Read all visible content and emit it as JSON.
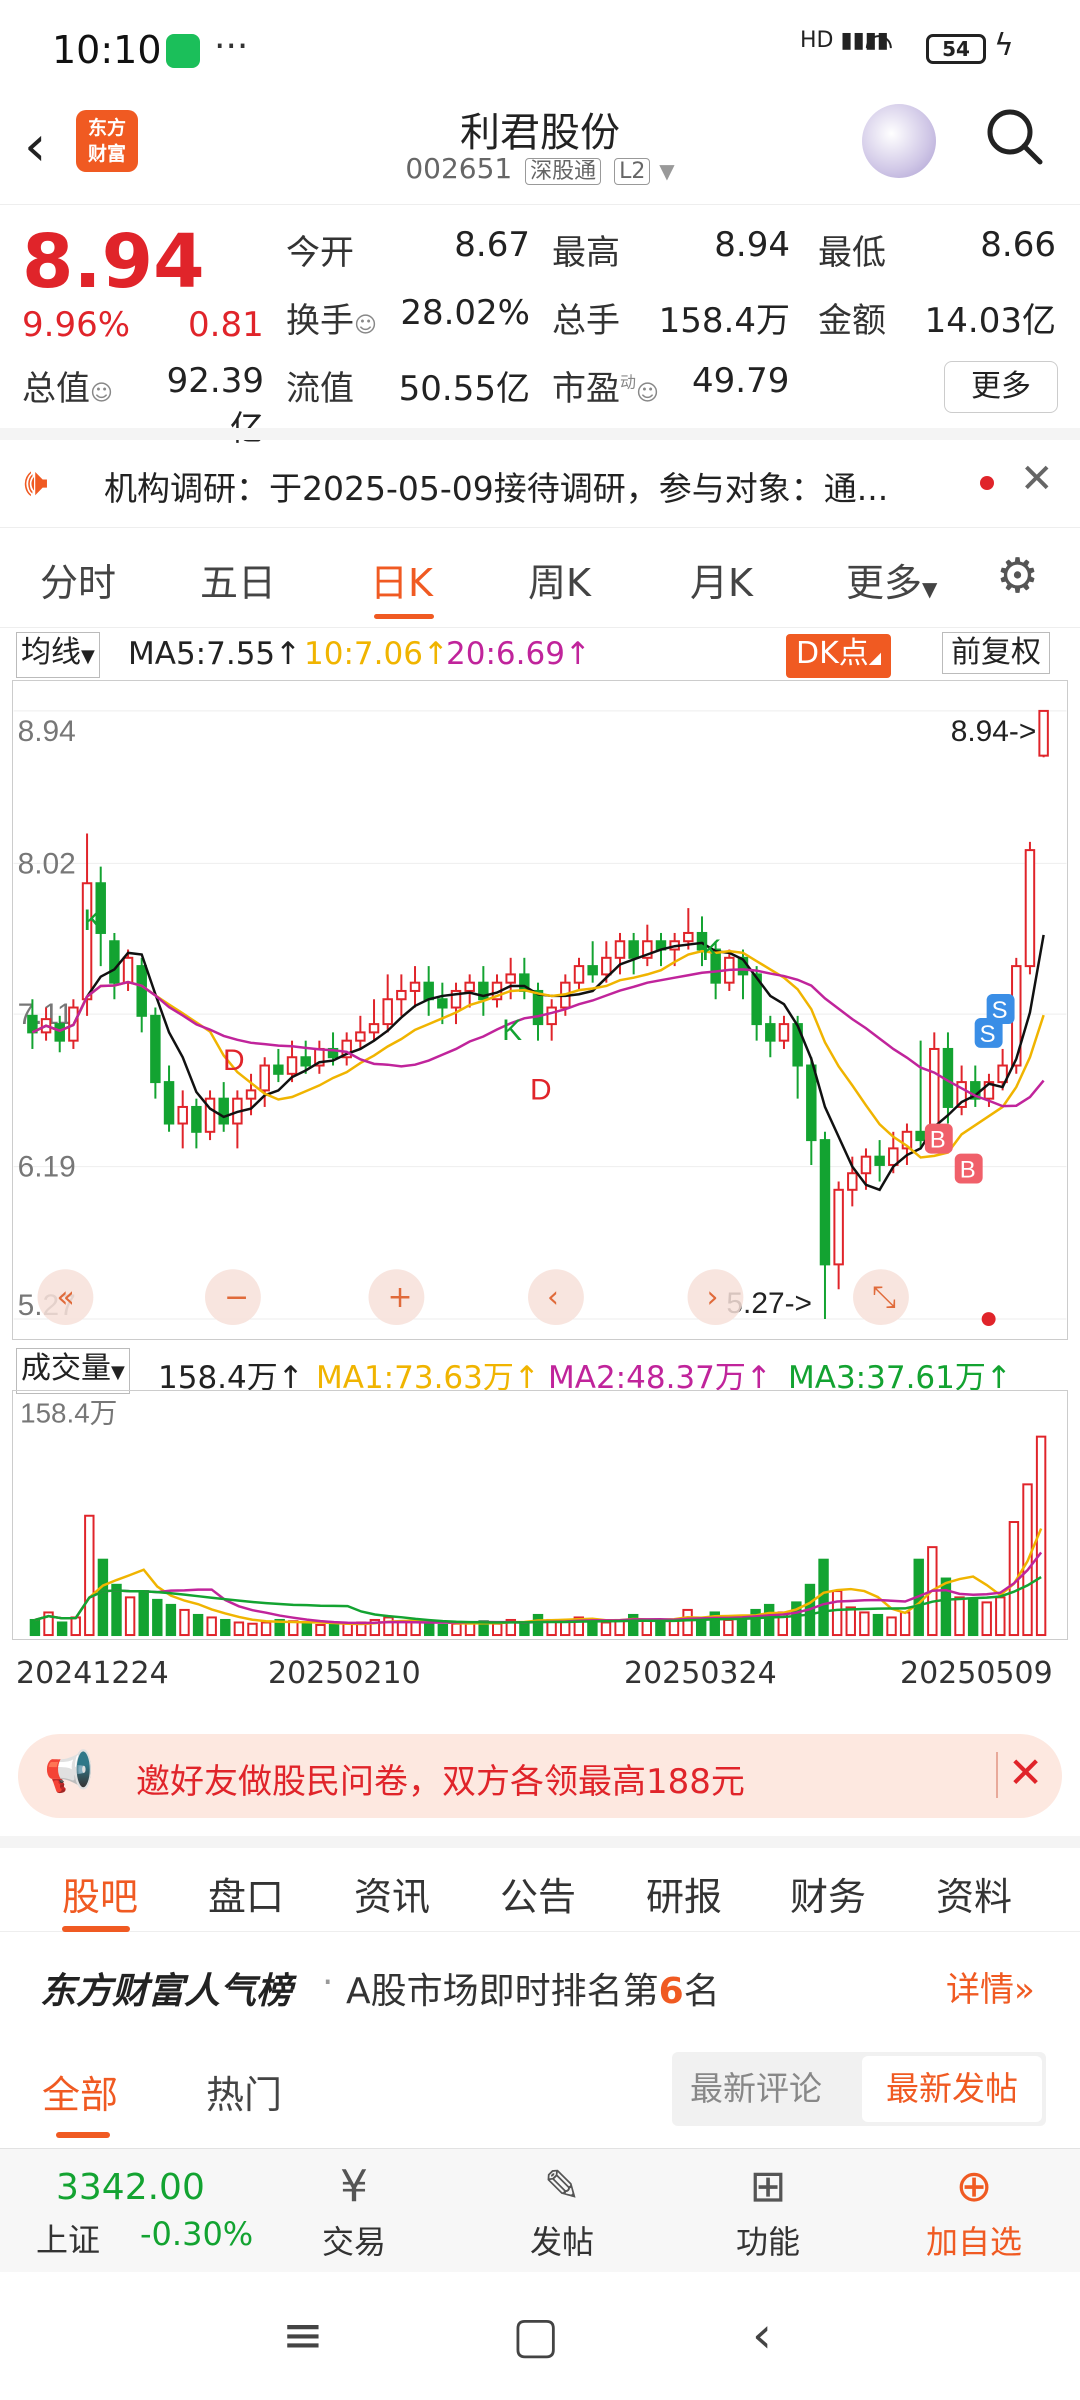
{
  "status_bar": {
    "time": "10:10",
    "battery": "54",
    "signal": "HD"
  },
  "header": {
    "stock_name": "利君股份",
    "stock_code": "002651",
    "market_tag": "深股通",
    "level_tag": "L2",
    "logo_text_1": "东方",
    "logo_text_2": "财富"
  },
  "quote": {
    "price": "8.94",
    "change_pct": "9.96%",
    "change_val": "0.81",
    "fields": [
      {
        "label": "今开",
        "value": "8.67",
        "color": "#e0242a"
      },
      {
        "label": "最高",
        "value": "8.94",
        "color": "#e0242a"
      },
      {
        "label": "最低",
        "value": "8.66",
        "color": "#e0242a"
      },
      {
        "label": "换手",
        "value": "28.02%",
        "color": "#222222"
      },
      {
        "label": "总手",
        "value": "158.4万",
        "color": "#222222"
      },
      {
        "label": "金额",
        "value": "14.03亿",
        "color": "#222222"
      },
      {
        "label": "总值",
        "value": "92.39亿",
        "color": "#222222"
      },
      {
        "label": "流值",
        "value": "50.55亿",
        "color": "#222222"
      },
      {
        "label": "市盈",
        "value": "49.79",
        "color": "#222222"
      }
    ],
    "more": "更多",
    "pe_sup": "动"
  },
  "ticker": {
    "text": "机构调研：于2025-05-09接待调研，参与对象：通..."
  },
  "chart_tabs": [
    "分时",
    "五日",
    "日K",
    "周K",
    "月K",
    "更多"
  ],
  "ma_row": {
    "selector": "均线",
    "ma5": "MA5:7.55",
    "ma10": "10:7.06",
    "ma20": "20:6.69",
    "dk": "DK点",
    "fq": "前复权"
  },
  "chart_data": {
    "type": "candlestick",
    "y_ticks": [
      "8.94",
      "8.02",
      "7.11",
      "6.19",
      "5.27"
    ],
    "ylim": [
      5.27,
      8.94
    ],
    "high_marker": "8.94->",
    "low_marker": "5.27->",
    "signal_labels": [
      "K",
      "D",
      "K",
      "D",
      "K",
      "S",
      "S",
      "B",
      "B"
    ],
    "dates": [
      "20241224",
      "20250210",
      "20250324",
      "20250509"
    ],
    "candles": [
      [
        7.1,
        7.0,
        7.2,
        6.9
      ],
      [
        7.0,
        7.08,
        7.15,
        6.95
      ],
      [
        7.05,
        6.95,
        7.1,
        6.88
      ],
      [
        6.95,
        7.15,
        7.2,
        6.9
      ],
      [
        7.2,
        7.9,
        8.2,
        7.1
      ],
      [
        7.9,
        7.6,
        8.0,
        7.4
      ],
      [
        7.55,
        7.3,
        7.6,
        7.2
      ],
      [
        7.3,
        7.45,
        7.5,
        7.25
      ],
      [
        7.4,
        7.1,
        7.45,
        7.0
      ],
      [
        7.1,
        6.7,
        7.15,
        6.6
      ],
      [
        6.7,
        6.45,
        6.8,
        6.4
      ],
      [
        6.45,
        6.55,
        6.65,
        6.3
      ],
      [
        6.55,
        6.4,
        6.6,
        6.3
      ],
      [
        6.4,
        6.6,
        6.65,
        6.35
      ],
      [
        6.6,
        6.45,
        6.7,
        6.4
      ],
      [
        6.45,
        6.6,
        6.65,
        6.3
      ],
      [
        6.6,
        6.65,
        6.75,
        6.5
      ],
      [
        6.65,
        6.8,
        6.85,
        6.55
      ],
      [
        6.8,
        6.75,
        6.9,
        6.7
      ],
      [
        6.75,
        6.85,
        6.95,
        6.7
      ],
      [
        6.85,
        6.8,
        6.95,
        6.75
      ],
      [
        6.8,
        6.9,
        6.95,
        6.75
      ],
      [
        6.9,
        6.85,
        7.0,
        6.8
      ],
      [
        6.85,
        6.95,
        7.0,
        6.8
      ],
      [
        6.95,
        7.0,
        7.1,
        6.9
      ],
      [
        7.0,
        7.05,
        7.2,
        6.95
      ],
      [
        7.05,
        7.2,
        7.35,
        7.0
      ],
      [
        7.2,
        7.25,
        7.35,
        7.1
      ],
      [
        7.25,
        7.3,
        7.4,
        7.15
      ],
      [
        7.3,
        7.2,
        7.4,
        7.1
      ],
      [
        7.2,
        7.15,
        7.3,
        7.05
      ],
      [
        7.15,
        7.25,
        7.3,
        7.05
      ],
      [
        7.25,
        7.3,
        7.35,
        7.15
      ],
      [
        7.3,
        7.2,
        7.4,
        7.1
      ],
      [
        7.2,
        7.3,
        7.35,
        7.15
      ],
      [
        7.3,
        7.35,
        7.45,
        7.2
      ],
      [
        7.35,
        7.25,
        7.45,
        7.2
      ],
      [
        7.25,
        7.05,
        7.3,
        6.95
      ],
      [
        7.05,
        7.15,
        7.2,
        6.95
      ],
      [
        7.15,
        7.3,
        7.35,
        7.1
      ],
      [
        7.3,
        7.4,
        7.45,
        7.25
      ],
      [
        7.4,
        7.35,
        7.55,
        7.3
      ],
      [
        7.35,
        7.45,
        7.55,
        7.3
      ],
      [
        7.45,
        7.55,
        7.6,
        7.35
      ],
      [
        7.55,
        7.45,
        7.6,
        7.35
      ],
      [
        7.45,
        7.55,
        7.65,
        7.4
      ],
      [
        7.55,
        7.5,
        7.6,
        7.4
      ],
      [
        7.5,
        7.55,
        7.6,
        7.4
      ],
      [
        7.55,
        7.6,
        7.75,
        7.5
      ],
      [
        7.6,
        7.5,
        7.7,
        7.4
      ],
      [
        7.5,
        7.3,
        7.55,
        7.2
      ],
      [
        7.3,
        7.45,
        7.5,
        7.25
      ],
      [
        7.45,
        7.35,
        7.5,
        7.2
      ],
      [
        7.35,
        7.05,
        7.4,
        6.95
      ],
      [
        7.05,
        6.95,
        7.1,
        6.85
      ],
      [
        6.95,
        7.05,
        7.1,
        6.9
      ],
      [
        7.05,
        6.8,
        7.1,
        6.6
      ],
      [
        6.8,
        6.35,
        6.85,
        6.2
      ],
      [
        6.35,
        5.6,
        6.4,
        5.27
      ],
      [
        5.6,
        6.05,
        6.1,
        5.45
      ],
      [
        6.05,
        6.15,
        6.25,
        5.95
      ],
      [
        6.15,
        6.25,
        6.3,
        6.05
      ],
      [
        6.25,
        6.2,
        6.35,
        6.1
      ],
      [
        6.2,
        6.3,
        6.4,
        6.15
      ],
      [
        6.3,
        6.4,
        6.45,
        6.2
      ],
      [
        6.4,
        6.35,
        6.95,
        6.3
      ],
      [
        6.35,
        6.9,
        7.0,
        6.3
      ],
      [
        6.9,
        6.55,
        7.0,
        6.45
      ],
      [
        6.55,
        6.7,
        6.8,
        6.5
      ],
      [
        6.7,
        6.6,
        6.8,
        6.55
      ],
      [
        6.6,
        6.7,
        6.75,
        6.55
      ],
      [
        6.7,
        6.8,
        6.9,
        6.65
      ],
      [
        6.8,
        7.4,
        7.45,
        6.75
      ],
      [
        7.4,
        8.1,
        8.15,
        7.35
      ],
      [
        8.67,
        8.94,
        8.94,
        8.66
      ]
    ]
  },
  "volume": {
    "selector": "成交量",
    "current": "158.4万",
    "ma1": "MA1:73.63万",
    "ma2": "MA2:48.37万",
    "ma3": "MA3:37.61万",
    "max_label": "158.4万"
  },
  "banner": {
    "text": "邀好友做股民问卷，双方各领最高188元"
  },
  "bottom_tabs": [
    "股吧",
    "盘口",
    "资讯",
    "公告",
    "研报",
    "财务",
    "资料"
  ],
  "rank": {
    "title": "东方财富人气榜",
    "text_pre": "A股市场即时排名第",
    "num": "6",
    "text_post": "名",
    "detail": "详情"
  },
  "feed_tabs": [
    "全部",
    "热门"
  ],
  "sort": [
    "最新评论",
    "最新发帖"
  ],
  "index": {
    "value": "3342.00",
    "name": "上证",
    "change": "-0.30%"
  },
  "bottom_bar": [
    "交易",
    "发帖",
    "功能",
    "加自选"
  ]
}
